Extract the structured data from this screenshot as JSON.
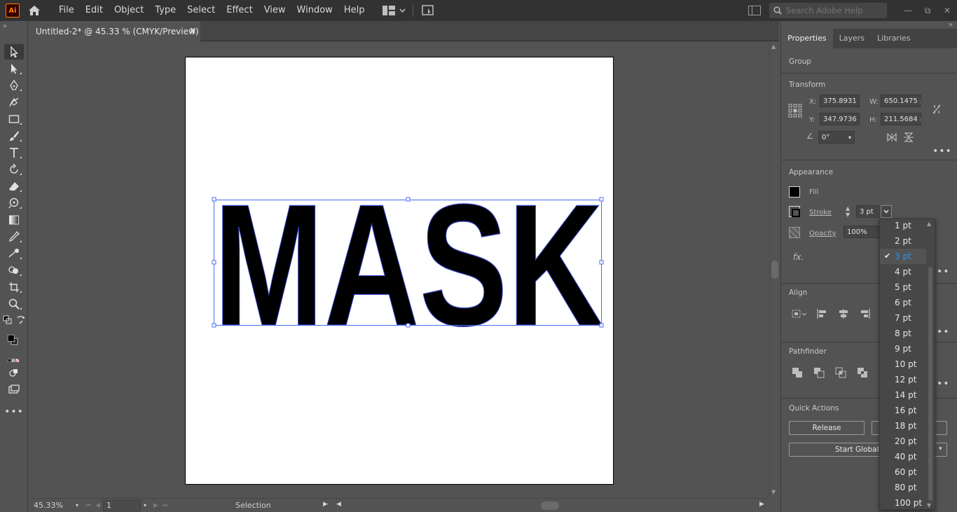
{
  "app": {
    "logo_text": "Ai",
    "menu": [
      "File",
      "Edit",
      "Object",
      "Type",
      "Select",
      "Effect",
      "View",
      "Window",
      "Help"
    ],
    "search_placeholder": "Search Adobe Help"
  },
  "document": {
    "tab_title": "Untitled-2* @ 45.33 % (CMYK/Preview)",
    "artwork_text": "MASK"
  },
  "status": {
    "zoom": "45.33%",
    "page": "1",
    "tool_name": "Selection"
  },
  "panel": {
    "tabs": [
      "Properties",
      "Layers",
      "Libraries"
    ],
    "selection_type": "Group",
    "transform": {
      "label": "Transform",
      "x_label": "X:",
      "x": "375.8931 p",
      "y_label": "Y:",
      "y": "347.9736 p",
      "w_label": "W:",
      "w": "650.1475 p",
      "h_label": "H:",
      "h": "211.5684 p",
      "angle": "0°"
    },
    "appearance": {
      "label": "Appearance",
      "fill_label": "Fill",
      "stroke_label": "Stroke",
      "stroke_value": "3 pt",
      "opacity_label": "Opacity",
      "opacity_value": "100%",
      "fx_label": "fx."
    },
    "align_label": "Align",
    "pathfinder_label": "Pathfinder",
    "quick_actions": {
      "label": "Quick Actions",
      "release_button": "Release",
      "global_edit_button": "Start Global Ed"
    }
  },
  "stroke_dropdown": {
    "options": [
      "1 pt",
      "2 pt",
      "3 pt",
      "4 pt",
      "5 pt",
      "6 pt",
      "7 pt",
      "8 pt",
      "9 pt",
      "10 pt",
      "12 pt",
      "14 pt",
      "16 pt",
      "18 pt",
      "20 pt",
      "40 pt",
      "60 pt",
      "80 pt",
      "100 pt"
    ],
    "selected": "3 pt"
  }
}
